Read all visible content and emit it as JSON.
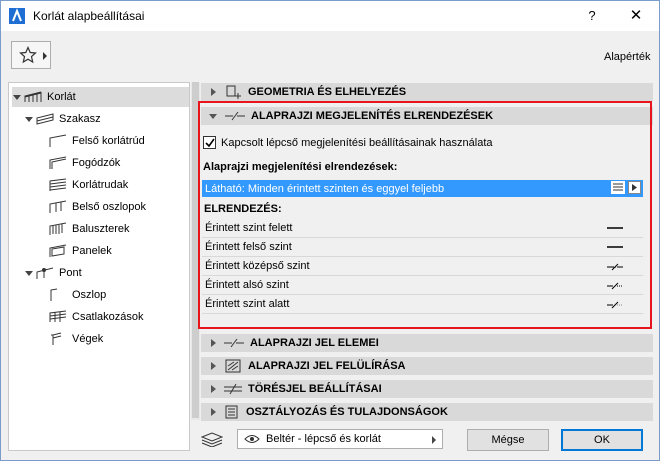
{
  "window": {
    "title": "Korlát alapbeállításai",
    "help_glyph": "?",
    "close_glyph": "✕",
    "defaults_label": "Alapérték"
  },
  "tree": {
    "root": "Korlát",
    "segment": "Szakasz",
    "segment_children": [
      "Felső korlátrúd",
      "Fogódzók",
      "Korlátrudak",
      "Belső oszlopok",
      "Baluszterek",
      "Panelek"
    ],
    "node": "Pont",
    "node_children": [
      "Oszlop",
      "Csatlakozások",
      "Végek"
    ]
  },
  "panels": {
    "geometry": "GEOMETRIA ÉS ELHELYEZÉS",
    "floorplan_display": "ALAPRAJZI MEGJELENÍTÉS ELRENDEZÉSEK",
    "floorplan_symbol": "ALAPRAJZI JEL ELEMEI",
    "floorplan_override": "ALAPRAJZI JEL FELÜLÍRÁSA",
    "break_mark": "TÖRÉSJEL BEÁLLÍTÁSAI",
    "classification": "OSZTÁLYOZÁS ÉS TULAJDONSÁGOK"
  },
  "display_settings": {
    "checkbox_label": "Kapcsolt lépcső megjelenítési beállításainak használata",
    "checkbox_checked": true,
    "section_label": "Alaprajzi megjelenítési elrendezések:",
    "selected_value": "Látható: Minden érintett szinten és eggyel feljebb",
    "arrangements_label": "ELRENDEZÉS:",
    "rows": [
      {
        "label": "Érintett szint felett",
        "symbol": "solid-line-icon"
      },
      {
        "label": "Érintett felső szint",
        "symbol": "solid-line-icon"
      },
      {
        "label": "Érintett középső szint",
        "symbol": "break-line-icon"
      },
      {
        "label": "Érintett alsó szint",
        "symbol": "break-line-icon"
      },
      {
        "label": "Érintett szint alatt",
        "symbol": "half-break-line-icon"
      }
    ]
  },
  "footer": {
    "favorite_value": "Beltér - lépcső és korlát",
    "cancel_label": "Mégse",
    "ok_label": "OK"
  },
  "colors": {
    "selection": "#3399ff",
    "highlight_border": "#e8141b",
    "header_bg": "#d9d9d9"
  }
}
